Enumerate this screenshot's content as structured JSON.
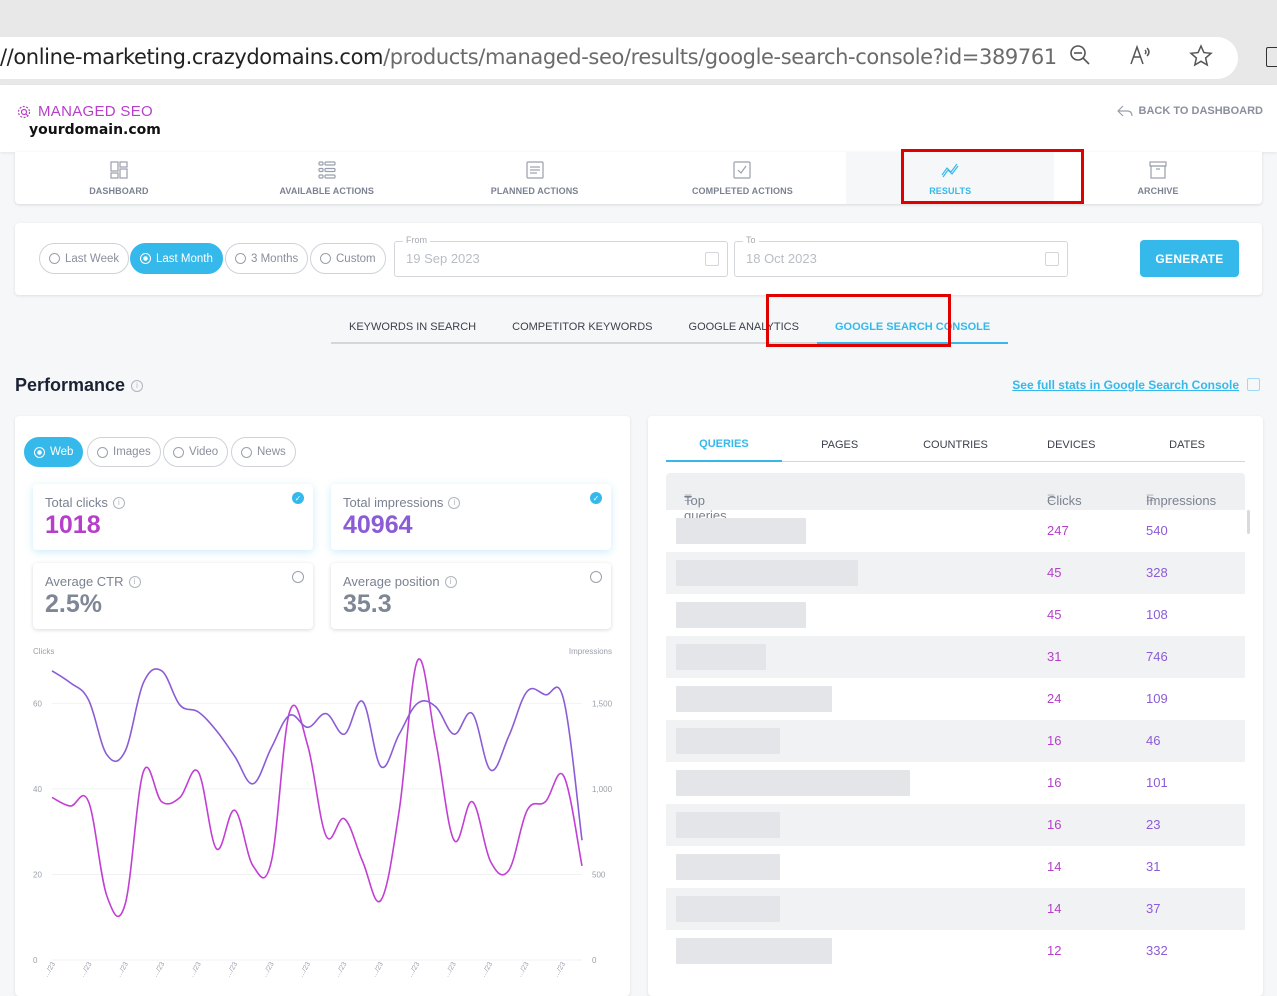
{
  "browser": {
    "url_host": "//online-marketing.crazydomains.com",
    "url_path": "/products/managed-seo/results/google-search-console?id=389761",
    "icons": [
      "zoom-out-icon",
      "read-aloud-icon",
      "favorite-star-icon"
    ]
  },
  "header": {
    "brand": "MANAGED SEO",
    "domain": "yourdomain.com",
    "back_label": "BACK TO DASHBOARD"
  },
  "nav": {
    "items": [
      {
        "label": "DASHBOARD",
        "icon": "dashboard-icon"
      },
      {
        "label": "AVAILABLE ACTIONS",
        "icon": "list-icon"
      },
      {
        "label": "PLANNED ACTIONS",
        "icon": "document-icon"
      },
      {
        "label": "COMPLETED ACTIONS",
        "icon": "checkbox-icon"
      },
      {
        "label": "RESULTS",
        "icon": "trend-icon",
        "active": true
      },
      {
        "label": "ARCHIVE",
        "icon": "archive-icon"
      }
    ]
  },
  "filters": {
    "ranges": [
      "Last Week",
      "Last Month",
      "3 Months",
      "Custom"
    ],
    "selected_range": "Last Month",
    "from_label": "From",
    "from_value": "19 Sep 2023",
    "to_label": "To",
    "to_value": "18 Oct 2023",
    "generate_label": "GENERATE"
  },
  "subtabs": {
    "items": [
      "KEYWORDS IN SEARCH",
      "COMPETITOR KEYWORDS",
      "GOOGLE ANALYTICS",
      "GOOGLE SEARCH CONSOLE"
    ],
    "active": "GOOGLE SEARCH CONSOLE"
  },
  "performance": {
    "title": "Performance",
    "full_stats_link": "See full stats in Google Search Console",
    "search_types": [
      "Web",
      "Images",
      "Video",
      "News"
    ],
    "selected_type": "Web",
    "metrics": [
      {
        "label": "Total clicks",
        "value": "1018",
        "selected": true,
        "color": "#b63fc9"
      },
      {
        "label": "Total impressions",
        "value": "40964",
        "selected": true,
        "color": "#8b5cd6"
      },
      {
        "label": "Average CTR",
        "value": "2.5%",
        "selected": false,
        "color": "#7f8796"
      },
      {
        "label": "Average position",
        "value": "35.3",
        "selected": false,
        "color": "#7f8796"
      }
    ]
  },
  "chart_data": {
    "type": "line",
    "left_axis_label": "Clicks",
    "right_axis_label": "Impressions",
    "left_ticks": [
      "0",
      "20",
      "40",
      "60"
    ],
    "right_ticks": [
      "0",
      "500",
      "1,000",
      "1,500"
    ],
    "left_ylim": [
      0,
      72
    ],
    "right_ylim": [
      0,
      1800
    ],
    "grid": true,
    "x_tick_labels_note": "rotated date labels (illegible, e.g. ../23)",
    "x_tick_count": 15,
    "series": [
      {
        "name": "Clicks",
        "axis": "left",
        "color": "#c23fd4",
        "values": [
          38,
          36,
          37,
          15,
          13,
          44,
          37,
          38,
          44,
          26,
          35,
          22,
          23,
          58,
          50,
          29,
          33,
          23,
          14,
          35,
          70,
          51,
          28,
          37,
          23,
          21,
          35,
          37,
          43,
          22
        ]
      },
      {
        "name": "Impressions",
        "axis": "right",
        "color": "#8b5cd6",
        "values": [
          1690,
          1620,
          1520,
          1200,
          1220,
          1620,
          1690,
          1490,
          1450,
          1340,
          1190,
          1030,
          1240,
          1430,
          1360,
          1440,
          1320,
          1510,
          1130,
          1320,
          1500,
          1480,
          1320,
          1440,
          1110,
          1310,
          1570,
          1550,
          1520,
          700
        ]
      }
    ]
  },
  "queries_panel": {
    "tabs": [
      "QUERIES",
      "PAGES",
      "COUNTRIES",
      "DEVICES",
      "DATES"
    ],
    "active_tab": "QUERIES",
    "columns": [
      "Top queries",
      "Clicks",
      "Impressions"
    ],
    "rows": [
      {
        "query": "[blurred]",
        "clicks": "247",
        "impressions": "540"
      },
      {
        "query": "[blurred]",
        "clicks": "45",
        "impressions": "328"
      },
      {
        "query": "[blurred]",
        "clicks": "45",
        "impressions": "108"
      },
      {
        "query": "[blurred]",
        "clicks": "31",
        "impressions": "746"
      },
      {
        "query": "[blurred]",
        "clicks": "24",
        "impressions": "109"
      },
      {
        "query": "[blurred]",
        "clicks": "16",
        "impressions": "46"
      },
      {
        "query": "[blurred]",
        "clicks": "16",
        "impressions": "101"
      },
      {
        "query": "[blurred]",
        "clicks": "16",
        "impressions": "23"
      },
      {
        "query": "[blurred]",
        "clicks": "14",
        "impressions": "31"
      },
      {
        "query": "[blurred]",
        "clicks": "14",
        "impressions": "37"
      },
      {
        "query": "[blurred]",
        "clicks": "12",
        "impressions": "332"
      }
    ]
  }
}
